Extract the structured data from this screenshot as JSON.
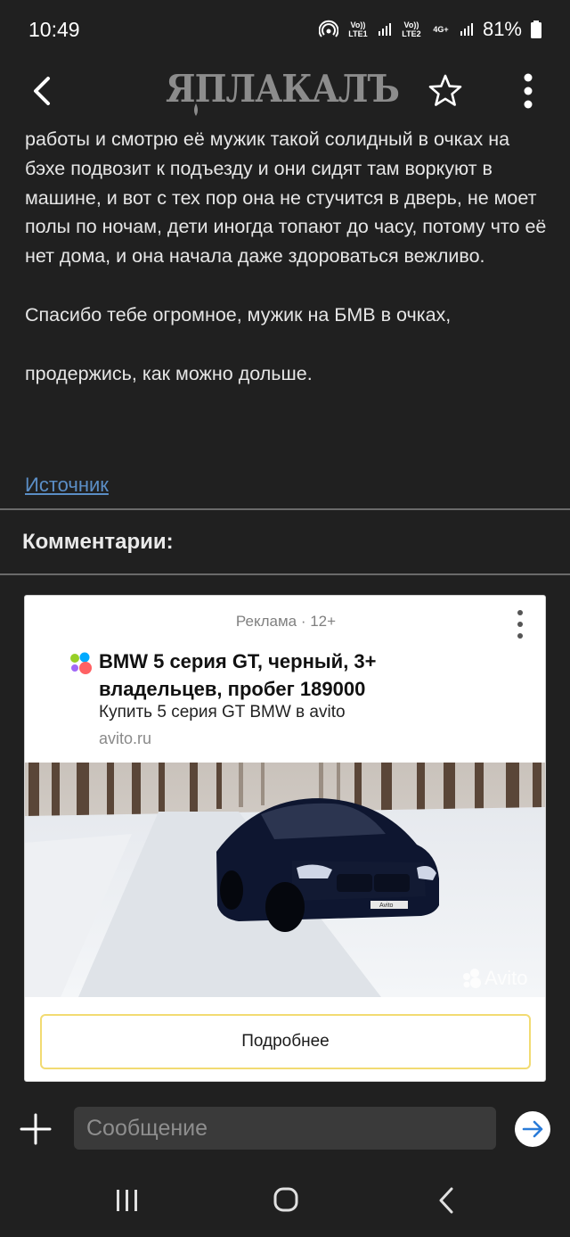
{
  "status_bar": {
    "time": "10:49",
    "sim1_label": "Vo)) LTE1",
    "sim2_label": "Vo)) LTE2",
    "data_label": "4G+",
    "battery": "81%"
  },
  "header": {
    "logo_text": "ЯПЛАКАЛЪ",
    "icons": [
      "back-arrow-icon",
      "star-icon",
      "more-vertical-icon"
    ]
  },
  "article": {
    "paragraph1": "работы и смотрю её мужик такой солидный в очках на бэхе подвозит к подъезду и они сидят там воркуют в машине, и вот с тех пор она не стучится в дверь, не моет полы по ночам, дети иногда топают до часу, потому что её нет дома, и она начала даже здороваться вежливо.",
    "paragraph2": "Спасибо тебе огромное, мужик на БМВ в очках,",
    "paragraph3": "продержись, как можно дольше.",
    "source_link": "Источник"
  },
  "comments": {
    "heading": "Комментарии:"
  },
  "ad": {
    "label": "Реклама · 12+",
    "title": "BMW 5 серия GT, черный, 3+ владельцев, пробег 189000",
    "subtitle": "Купить 5 серия GT BMW в avito",
    "domain": "avito.ru",
    "watermark": "Avito",
    "button": "Подробнее",
    "plate_text": "Avito"
  },
  "message_bar": {
    "placeholder": "Сообщение"
  },
  "colors": {
    "background": "#202020",
    "link": "#5b8ec6",
    "button_border": "#f2db72",
    "send_arrow": "#2a7bd8"
  }
}
